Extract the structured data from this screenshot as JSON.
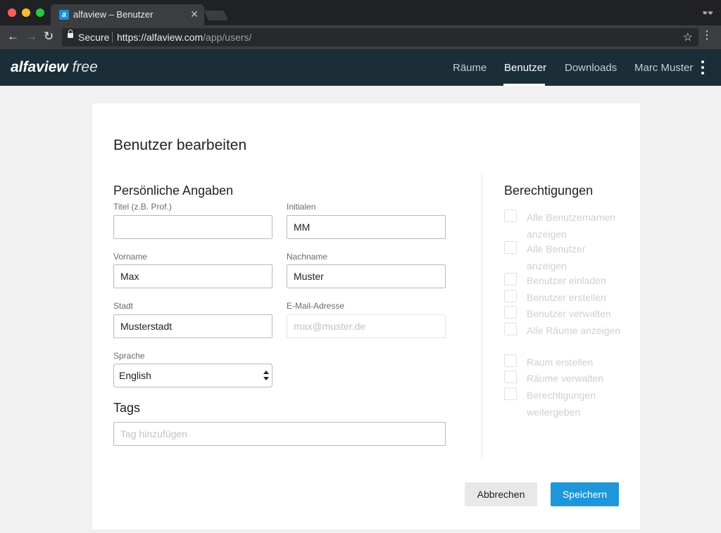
{
  "browser": {
    "tab_title": "alfaview – Benutzer",
    "tab_favicon_letter": "a",
    "security_label": "Secure",
    "url_host": "https://alfaview.com",
    "url_path": "/app/users/"
  },
  "app": {
    "logo_bold": "alfaview",
    "logo_light": "free",
    "nav": [
      {
        "label": "Räume"
      },
      {
        "label": "Benutzer"
      },
      {
        "label": "Downloads"
      },
      {
        "label": "Marc Muster"
      }
    ],
    "active_nav": "Benutzer"
  },
  "form": {
    "page_title": "Benutzer bearbeiten",
    "personal_heading": "Persönliche Angaben",
    "fields": {
      "titel": {
        "label": "Titel (z.B. Prof.)",
        "value": ""
      },
      "initialen": {
        "label": "Initialen",
        "value": "MM"
      },
      "vorname": {
        "label": "Vorname",
        "value": "Max"
      },
      "nachname": {
        "label": "Nachname",
        "value": "Muster"
      },
      "stadt": {
        "label": "Stadt",
        "value": "Musterstadt"
      },
      "email": {
        "label": "E-Mail-Adresse",
        "placeholder": "max@muster.de",
        "disabled": true
      },
      "sprache": {
        "label": "Sprache",
        "value": "English"
      }
    },
    "tags_heading": "Tags",
    "tags_placeholder": "Tag hinzufügen",
    "permissions_heading": "Berechtigungen",
    "permissions": [
      {
        "label": "Alle Benutzernamen anzeigen",
        "checked": false
      },
      {
        "label": "Alle Benutzer anzeigen",
        "checked": false
      },
      {
        "label": "Benutzer einladen",
        "checked": false
      },
      {
        "label": "Benutzer erstellen",
        "checked": false
      },
      {
        "label": "Benutzer verwalten",
        "checked": false
      },
      {
        "label": "Alle Räume anzeigen",
        "checked": false
      },
      {
        "label": "Raum erstellen",
        "checked": false
      },
      {
        "label": "Räume verwalten",
        "checked": false
      },
      {
        "label": "Berechtigungen weitergeben",
        "checked": false
      }
    ],
    "cancel_label": "Abbrechen",
    "save_label": "Speichern"
  },
  "colors": {
    "header_bg": "#1b2d36",
    "accent": "#1e96d7",
    "page_bg": "#f1f1f2"
  }
}
